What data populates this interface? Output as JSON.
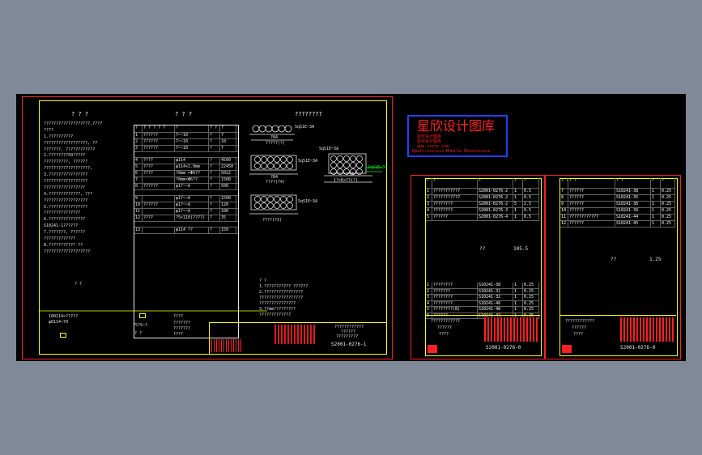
{
  "logo": {
    "title": "星欣设计图库",
    "line1": "星欣设计图库",
    "line2": "星欣设计图库",
    "url": "www.xxxxx.com",
    "contact": "Email:xxxxxxx Mobile:15xxxxxxxxx"
  },
  "sheet1": {
    "notes_heading": "? ? ?",
    "table_heading": "? ? ?",
    "drawing_heading": "????????",
    "notes": [
      "???????????????????,????",
      "????",
      "1.??????????",
      "??????????????????, ??",
      "???????, ????????????",
      "2.????????50?????",
      "??????????, ??????",
      "???????????????????,",
      "3.????????????????",
      "??????????????????",
      "?????????????????",
      "4.?????????????, ???",
      "??????????????????",
      "5.????????????????",
      "???????????????",
      "6.???????????????",
      "S10241-1??????",
      "7.???????, ??????",
      "?????????????",
      "8.??????????? ??",
      "???????????????????"
    ],
    "table_header": [
      "?",
      "? ? ? ? ?",
      "?",
      "? ?",
      "?"
    ],
    "table_rows": [
      [
        "1",
        "??????",
        "7~~10",
        "?",
        "7"
      ],
      [
        "2",
        "??????",
        "7~~10",
        "?",
        "10"
      ],
      [
        "3",
        "??????",
        "7~~10",
        "?",
        "7"
      ],
      [
        "4",
        "????",
        "φ114",
        "?",
        "4500"
      ],
      [
        "5",
        "????",
        "φ114×2.0mm",
        "?",
        "22450"
      ],
      [
        "6",
        "????",
        "?0mm ×Φ6??",
        "?",
        "5022"
      ],
      [
        "7",
        "",
        "?0mm×Φ6??",
        "?",
        "1500"
      ],
      [
        "8",
        "??????",
        "φ1?~~A",
        "?",
        "500"
      ],
      [
        "9",
        "",
        "φ1?~~A",
        "?",
        "1500"
      ],
      [
        "10",
        "??????",
        "φ1?~~A",
        "?",
        "120"
      ],
      [
        "11",
        "",
        "φ1?~~A",
        "?",
        "100"
      ],
      [
        "12",
        "????",
        "?5×110(????)",
        "?",
        "35"
      ],
      [
        "13",
        "",
        "φ114  ??",
        "?",
        "150"
      ]
    ],
    "section_labels": [
      "SqS1E~3A",
      "SqS1E~3A",
      "SqS1E~3A",
      "SqS1E~3A",
      "SqS1E~3A"
    ],
    "dim_labels": [
      "?84",
      "?84",
      "?18",
      "????(?4)",
      "????(?3)",
      "?????(?)",
      "1?×6×??(?)"
    ],
    "bottom_notes": [
      "? ?",
      "1.??????????? ??????",
      "2.????????????????",
      "??????????????????",
      "???????????????",
      "3.??mm?????????",
      "?????????????"
    ],
    "legend": {
      "l1": "100114×?????",
      "l2": "φ8114~70",
      "l3": "? ?",
      "l4": "?5?S~?",
      "l5": "? ?",
      "l6": "????",
      "l7": "???????",
      "l8": "???????",
      "l9": "????"
    },
    "title_block": {
      "name1": "????????????",
      "name2": "??????",
      "name3": "?????????",
      "drawing_no": "S2001-0276-1"
    }
  },
  "sheet2": {
    "header": [
      "?",
      "?",
      "?",
      "?",
      "?"
    ],
    "rows_a": [
      [
        "1",
        "???????????",
        "S2001-0276-2",
        "1",
        "0.5"
      ],
      [
        "2",
        "???????????",
        "S2001-0276-2",
        "1",
        "0.5"
      ],
      [
        "3",
        "????????",
        "S2001-0276-2",
        "5",
        "2.5"
      ],
      [
        "4",
        "????????",
        "S2001-0276-3",
        "1",
        "0.5"
      ],
      [
        "5",
        "??????",
        "S2001-0276-4",
        "1",
        "0.5"
      ]
    ],
    "total_label": "??",
    "total_value": "105.5",
    "rows_b": [
      [
        "1",
        "????????",
        "S10241-38",
        "1",
        "0.25"
      ],
      [
        "2",
        "???????",
        "S10241-31",
        "1",
        "0.25"
      ],
      [
        "3",
        "????????",
        "S10241-32",
        "1",
        "0.25"
      ],
      [
        "4",
        "????????",
        "S10241-46",
        "1",
        "0.25"
      ],
      [
        "5",
        "????????(B)",
        "S10241-48",
        "1",
        "0.25"
      ],
      [
        "6",
        "??????",
        "S10241-47",
        "1",
        "0.25"
      ]
    ],
    "title_block": {
      "l1": "????????????",
      "l2": "??????",
      "l3": "????",
      "drawing_no": "S2001-0276-0"
    }
  },
  "sheet3": {
    "header": [
      "? ?",
      "? ?",
      "? ?",
      "?",
      "?"
    ],
    "rows": [
      [
        "7",
        "??????",
        "S10241-38",
        "1",
        "0.25"
      ],
      [
        "8",
        "??????",
        "S10241-35",
        "1",
        "0.25"
      ],
      [
        "9",
        "??????",
        "S10241-36",
        "1",
        "0.25"
      ],
      [
        "10",
        "??????",
        "S10241-39",
        "1",
        "0.25"
      ],
      [
        "11",
        "????????????",
        "S10241-44",
        "1",
        "0.25"
      ],
      [
        "12",
        "??????",
        "S10241-45",
        "1",
        "0.25"
      ]
    ],
    "total_label": "??",
    "total_value": "1.25",
    "title_block": {
      "l1": "????????????",
      "l2": "??????",
      "l3": "????",
      "drawing_no": "S2001-0276-0"
    }
  }
}
